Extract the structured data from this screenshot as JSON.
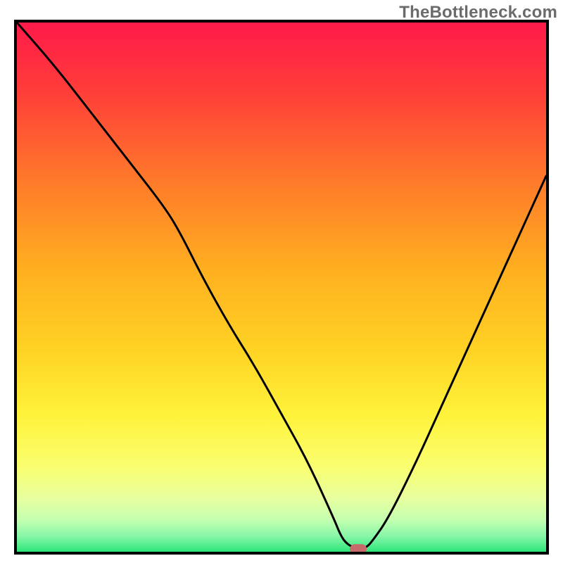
{
  "watermark": "TheBottleneck.com",
  "chart_data": {
    "type": "line",
    "title": "",
    "xlabel": "",
    "ylabel": "",
    "xlim": [
      0,
      100
    ],
    "ylim": [
      0,
      100
    ],
    "x": [
      0,
      7,
      14,
      21,
      28,
      31,
      35,
      40,
      45,
      50,
      55,
      60,
      61,
      62,
      63.5,
      65,
      66,
      67,
      70,
      75,
      80,
      85,
      90,
      95,
      100
    ],
    "y": [
      100,
      92,
      83,
      74,
      65,
      60,
      52,
      43,
      35,
      26,
      17,
      6,
      3.5,
      1.8,
      0.8,
      0.6,
      0.8,
      1.8,
      6,
      16,
      27,
      38,
      49,
      60,
      71
    ],
    "minimum_marker": {
      "x": 64.5,
      "y": 0.5,
      "color": "#c66a6a"
    },
    "gradient_stops": [
      {
        "offset": 0.0,
        "color": "#ff1a4a"
      },
      {
        "offset": 0.12,
        "color": "#ff3a3a"
      },
      {
        "offset": 0.3,
        "color": "#ff7a2a"
      },
      {
        "offset": 0.47,
        "color": "#ffb020"
      },
      {
        "offset": 0.62,
        "color": "#ffd324"
      },
      {
        "offset": 0.74,
        "color": "#fff23a"
      },
      {
        "offset": 0.84,
        "color": "#faff70"
      },
      {
        "offset": 0.9,
        "color": "#e7ffa0"
      },
      {
        "offset": 0.94,
        "color": "#c4ffb0"
      },
      {
        "offset": 0.97,
        "color": "#88f7a8"
      },
      {
        "offset": 1.0,
        "color": "#2ee67a"
      }
    ]
  }
}
